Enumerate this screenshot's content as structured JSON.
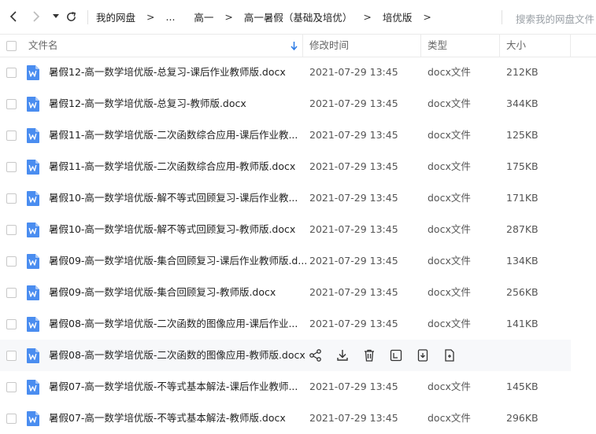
{
  "breadcrumb": {
    "items": [
      "我的网盘",
      "...",
      "高一",
      "高一暑假（基础及培优）",
      "培优版"
    ]
  },
  "search": {
    "placeholder": "搜索我的网盘文件"
  },
  "columns": {
    "name": "文件名",
    "modified": "修改时间",
    "type": "类型",
    "size": "大小"
  },
  "colors": {
    "accent": "#2c7be5",
    "word_icon": "#4a8df0",
    "row_hover": "#f7f8fa"
  },
  "files": [
    {
      "name": "暑假12-高一数学培优版-总复习-课后作业教师版.docx",
      "modified": "2021-07-29 13:45",
      "type": "docx文件",
      "size": "212KB"
    },
    {
      "name": "暑假12-高一数学培优版-总复习-教师版.docx",
      "modified": "2021-07-29 13:45",
      "type": "docx文件",
      "size": "344KB"
    },
    {
      "name": "暑假11-高一数学培优版-二次函数综合应用-课后作业教...",
      "modified": "2021-07-29 13:45",
      "type": "docx文件",
      "size": "125KB"
    },
    {
      "name": "暑假11-高一数学培优版-二次函数综合应用-教师版.docx",
      "modified": "2021-07-29 13:45",
      "type": "docx文件",
      "size": "175KB"
    },
    {
      "name": "暑假10-高一数学培优版-解不等式回顾复习-课后作业教...",
      "modified": "2021-07-29 13:45",
      "type": "docx文件",
      "size": "171KB"
    },
    {
      "name": "暑假10-高一数学培优版-解不等式回顾复习-教师版.docx",
      "modified": "2021-07-29 13:45",
      "type": "docx文件",
      "size": "287KB"
    },
    {
      "name": "暑假09-高一数学培优版-集合回顾复习-课后作业教师版.d...",
      "modified": "2021-07-29 13:45",
      "type": "docx文件",
      "size": "134KB"
    },
    {
      "name": "暑假09-高一数学培优版-集合回顾复习-教师版.docx",
      "modified": "2021-07-29 13:45",
      "type": "docx文件",
      "size": "256KB"
    },
    {
      "name": "暑假08-高一数学培优版-二次函数的图像应用-课后作业...",
      "modified": "2021-07-29 13:45",
      "type": "docx文件",
      "size": "141KB"
    },
    {
      "name": "暑假08-高一数学培优版-二次函数的图像应用-教师版.docx",
      "modified": "",
      "type": "",
      "size": "",
      "hover": true
    },
    {
      "name": "暑假07-高一数学培优版-不等式基本解法-课后作业教师...",
      "modified": "2021-07-29 13:45",
      "type": "docx文件",
      "size": "145KB"
    },
    {
      "name": "暑假07-高一数学培优版-不等式基本解法-教师版.docx",
      "modified": "2021-07-29 13:45",
      "type": "docx文件",
      "size": "296KB"
    }
  ],
  "hover_actions": [
    "share-icon",
    "download-icon",
    "delete-icon",
    "rename-icon",
    "move-icon",
    "copy-icon"
  ]
}
